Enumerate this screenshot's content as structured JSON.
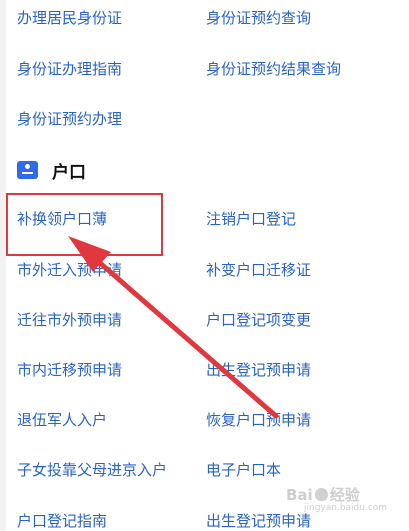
{
  "id_card_items": [
    {
      "label": "办理居民身份证"
    },
    {
      "label": "身份证预约查询"
    },
    {
      "label": "身份证办理指南"
    },
    {
      "label": "身份证预约结果查询"
    },
    {
      "label": "身份证预约办理"
    }
  ],
  "hukou_section": {
    "title": "户口",
    "icon": "user-card-icon",
    "items": [
      {
        "label": "补换领户口薄"
      },
      {
        "label": "注销户口登记"
      },
      {
        "label": "市外迁入预申请"
      },
      {
        "label": "补变户口迁移证"
      },
      {
        "label": "迁往市外预申请"
      },
      {
        "label": "户口登记项变更"
      },
      {
        "label": "市内迁移预申请"
      },
      {
        "label": "出生登记预申请"
      },
      {
        "label": "退伍军人入户"
      },
      {
        "label": "恢复户口预申请"
      },
      {
        "label": "子女投靠父母进京入户"
      },
      {
        "label": "电子户口本"
      },
      {
        "label": "户口登记指南"
      },
      {
        "label": "出生登记预申请"
      }
    ]
  },
  "annotation": {
    "highlight_color": "#e0383e",
    "arrow_color": "#e0383e"
  },
  "watermark": {
    "brand_left": "Bai",
    "brand_right": "经验",
    "sub": "jingyan.baidu.com"
  },
  "colors": {
    "link": "#2a63c8",
    "icon": "#2f6be8",
    "title": "#111111"
  }
}
